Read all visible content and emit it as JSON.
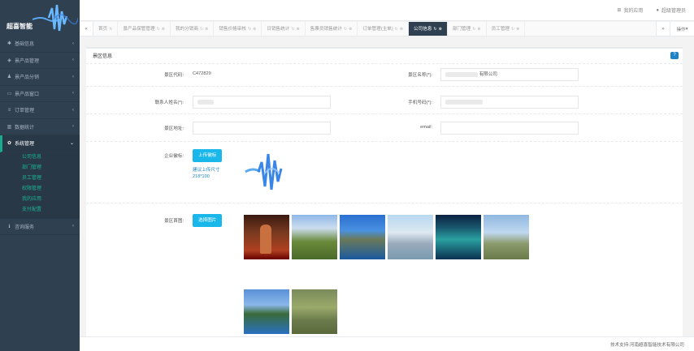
{
  "brand": {
    "name": "超喜智能"
  },
  "sidebar": {
    "items": [
      {
        "label": "基础信息",
        "icon": "home-icon"
      },
      {
        "label": "景产品管理",
        "icon": "cube-icon"
      },
      {
        "label": "景产品分销",
        "icon": "group-icon"
      },
      {
        "label": "景产品窗口",
        "icon": "desktop-icon"
      },
      {
        "label": "订单管理",
        "icon": "list-icon"
      },
      {
        "label": "数据统计",
        "icon": "chart-icon"
      },
      {
        "label": "系统管理",
        "icon": "gear-icon"
      }
    ],
    "sub_items": [
      "公司信息",
      "部门管理",
      "员工管理",
      "权限管理",
      "我的应用",
      "支付配置"
    ],
    "bottom_item": {
      "label": "咨询服务",
      "icon": "info-icon"
    }
  },
  "topbar": {
    "my_apps": "我的应用",
    "user": "超级管理员"
  },
  "tabs": {
    "items": [
      "首页",
      "景产品保管管理",
      "我的分销商",
      "销售价格审核",
      "日销售统计",
      "售票员销售统计",
      "订单管理(主单)",
      "公司信息",
      "部门管理",
      "员工管理"
    ],
    "active_index": 7,
    "ops_label": "操作"
  },
  "panel": {
    "title": "景区信息",
    "fields": {
      "code_label": "景区代码:",
      "code_value": "C472829",
      "name_label": "景区名称(*):",
      "name_value": "有限公司",
      "contact_label": "联系人姓名(*):",
      "phone_label": "手机号码(*):",
      "address_label": "景区地址:",
      "email_label": "email:",
      "logo_label": "企业徽标:",
      "upload_logo_btn": "上传徽标",
      "logo_hint": "建议上传尺寸 218*100",
      "photos_label": "景区首图:",
      "select_photos_btn": "选择图片"
    }
  },
  "footer": {
    "text": "技术支持:河南超喜智能技术有限公司"
  },
  "colors": {
    "sidebar": "#2f4050",
    "accent_green": "#1ab394",
    "accent_blue": "#1ab7ea"
  }
}
